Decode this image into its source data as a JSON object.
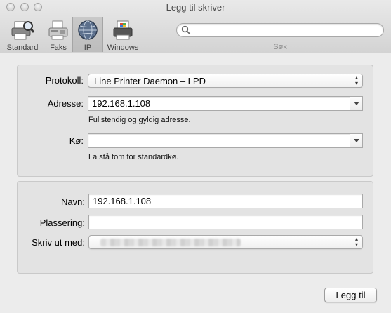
{
  "window": {
    "title": "Legg til skriver"
  },
  "toolbar": {
    "items": [
      {
        "label": "Standard",
        "icon": "printer-magnifier-icon"
      },
      {
        "label": "Faks",
        "icon": "fax-icon"
      },
      {
        "label": "IP",
        "icon": "globe-icon",
        "selected": true
      },
      {
        "label": "Windows",
        "icon": "windows-printer-icon"
      }
    ],
    "search": {
      "placeholder": "",
      "label": "Søk"
    }
  },
  "connection": {
    "protocol": {
      "label": "Protokoll:",
      "value": "Line Printer Daemon – LPD"
    },
    "address": {
      "label": "Adresse:",
      "value": "192.168.1.108",
      "hint": "Fullstendig og gyldig adresse."
    },
    "queue": {
      "label": "Kø:",
      "value": "",
      "hint": "La stå tom for standardkø."
    }
  },
  "details": {
    "name": {
      "label": "Navn:",
      "value": "192.168.1.108"
    },
    "location": {
      "label": "Plassering:",
      "value": ""
    },
    "print_using": {
      "label": "Skriv ut med:",
      "value": ""
    }
  },
  "actions": {
    "add_label": "Legg til"
  }
}
